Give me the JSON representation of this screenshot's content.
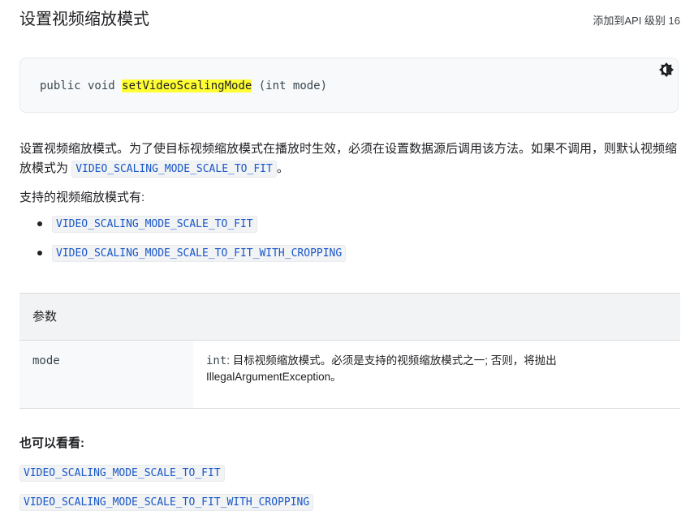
{
  "header": {
    "title": "设置视频缩放模式",
    "api_level": "添加到API 级别 16"
  },
  "signature": {
    "prefix": "public void ",
    "method": "setVideoScalingMode",
    "suffix": " (int mode)",
    "theme_toggle_icon": "brightness-contrast-icon"
  },
  "description": {
    "text_before": "设置视频缩放模式。为了使目标视频缩放模式在播放时生效，必须在设置数据源后调用该方法。如果不调用，则默认视频缩放模式为",
    "default_mode": "VIDEO_SCALING_MODE_SCALE_TO_FIT",
    "text_after": "。"
  },
  "supported": {
    "label": "支持的视频缩放模式有:",
    "modes": [
      "VIDEO_SCALING_MODE_SCALE_TO_FIT",
      "VIDEO_SCALING_MODE_SCALE_TO_FIT_WITH_CROPPING"
    ]
  },
  "params": {
    "header": "参数",
    "rows": [
      {
        "name": "mode",
        "type": "int",
        "desc": ": 目标视频缩放模式。必须是支持的视频缩放模式之一; 否则，将抛出 IllegalArgumentException。"
      }
    ]
  },
  "see_also": {
    "title": "也可以看看:",
    "links": [
      "VIDEO_SCALING_MODE_SCALE_TO_FIT",
      "VIDEO_SCALING_MODE_SCALE_TO_FIT_WITH_CROPPING"
    ]
  }
}
